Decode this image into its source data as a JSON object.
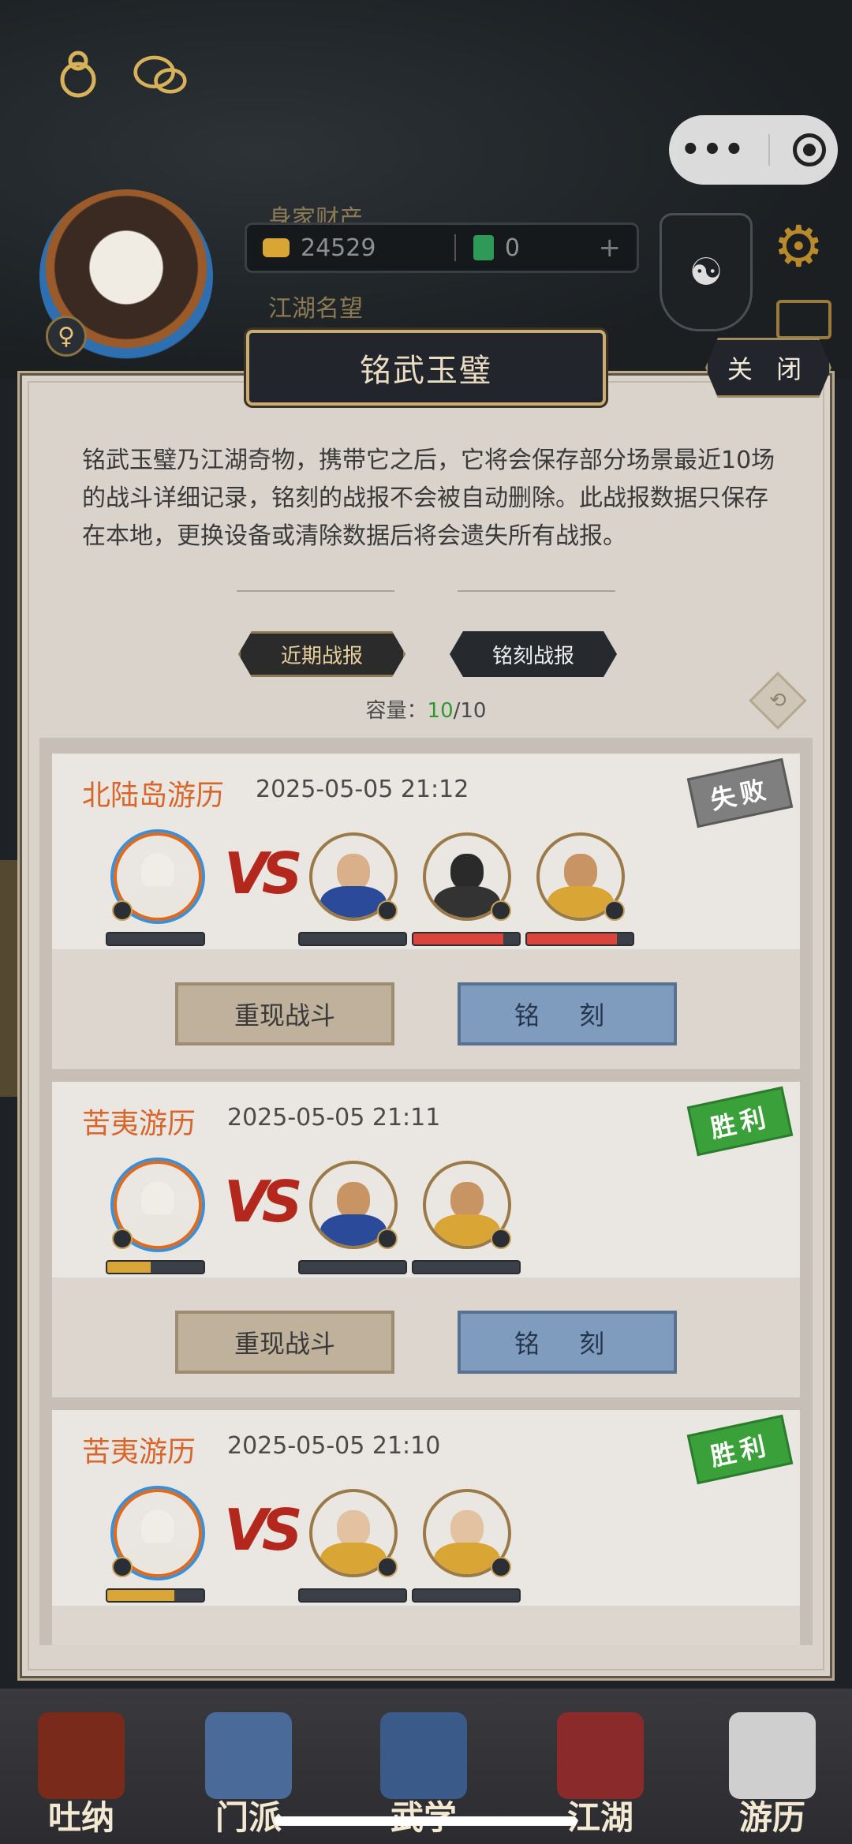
{
  "topbar": {
    "icons": [
      "profile-bun-icon",
      "chat-bubbles-icon"
    ],
    "capsule_more": "•••"
  },
  "player": {
    "gender_symbol": "♀",
    "wealth_label": "身家财产",
    "gold": "24529",
    "jade": "0",
    "plus": "+",
    "fame_label": "江湖名望"
  },
  "dialog": {
    "title": "铭武玉璧",
    "close_label": "关 闭",
    "description": "铭武玉璧乃江湖奇物，携带它之后，它将会保存部分场景最近10场的战斗详细记录，铭刻的战报不会被自动删除。此战报数据只保存在本地，更换设备或清除数据后将会遗失所有战报。",
    "tabs": [
      "近期战报",
      "铭刻战报"
    ],
    "capacity_label": "容量：",
    "capacity_used": "10",
    "capacity_total": "/10"
  },
  "battles": [
    {
      "place": "北陆岛游历",
      "time": "2025-05-05 21:12",
      "result": "失败",
      "result_type": "lose",
      "vs": "VS",
      "player_hp": 0,
      "enemies_hp": [
        0,
        0.85,
        0.85
      ],
      "replay_label": "重现战斗",
      "engrave_label": "铭 刻"
    },
    {
      "place": "苦夷游历",
      "time": "2025-05-05 21:11",
      "result": "胜利",
      "result_type": "win",
      "vs": "VS",
      "player_hp": 0.45,
      "enemies_hp": [
        0,
        0
      ],
      "replay_label": "重现战斗",
      "engrave_label": "铭 刻"
    },
    {
      "place": "苦夷游历",
      "time": "2025-05-05 21:10",
      "result": "胜利",
      "result_type": "win",
      "vs": "VS",
      "player_hp": 0.7,
      "enemies_hp": [
        0,
        0
      ]
    }
  ],
  "bottom_nav": [
    "吐纳",
    "门派",
    "武学",
    "江湖",
    "游历"
  ],
  "colors": {
    "accent_orange": "#d8662a",
    "win_green": "#3aa13a",
    "lose_gray": "#7f7f7f",
    "hp_red": "#d9453a",
    "hp_gold": "#d9a534"
  }
}
